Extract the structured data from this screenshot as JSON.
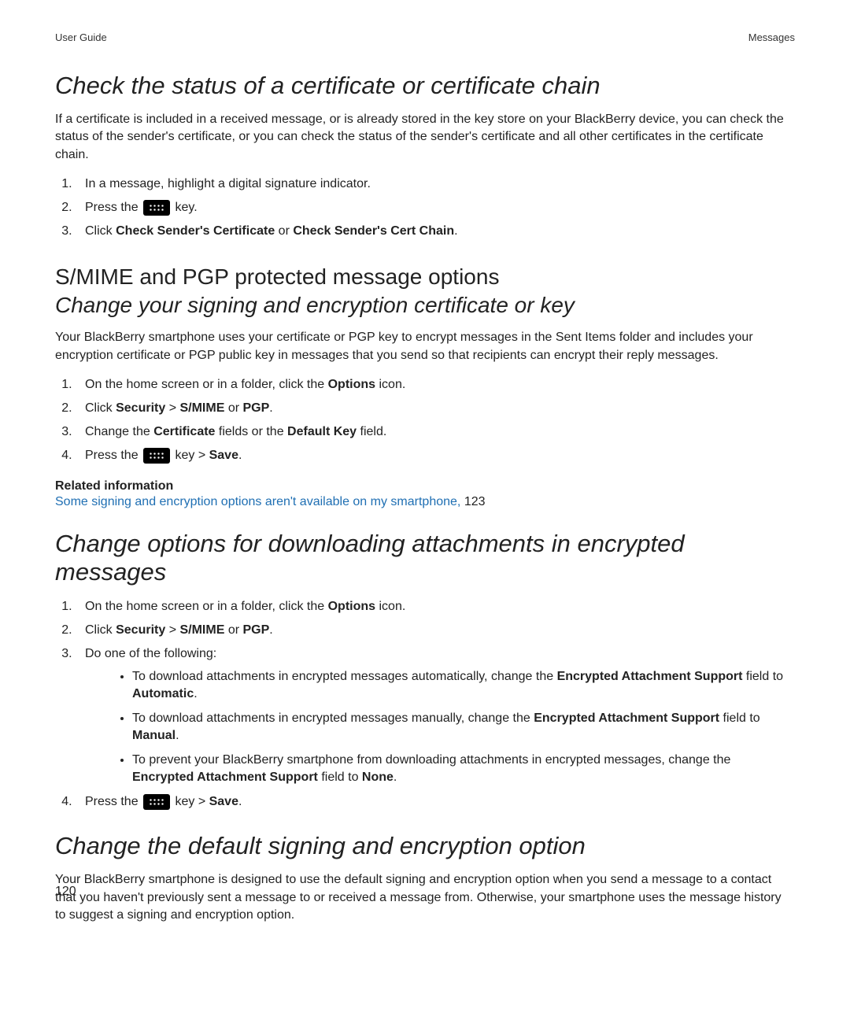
{
  "header": {
    "left": "User Guide",
    "right": "Messages"
  },
  "section1": {
    "title": "Check the status of a certificate or certificate chain",
    "para": "If a certificate is included in a received message, or is already stored in the key store on your BlackBerry device, you can check the status of the sender's certificate, or you can check the status of the sender's certificate and all other certificates in the certificate chain.",
    "steps": {
      "s1": "In a message, highlight a digital signature indicator.",
      "s2_before": "Press the ",
      "s2_after": " key.",
      "s3_a": "Click ",
      "s3_b": "Check Sender's Certificate",
      "s3_c": " or ",
      "s3_d": "Check Sender's Cert Chain",
      "s3_e": "."
    }
  },
  "section2": {
    "title1": "S/MIME and PGP protected message options",
    "title2": "Change your signing and encryption certificate or key",
    "para": "Your BlackBerry smartphone uses your certificate or PGP key to encrypt messages in the Sent Items folder and includes your encryption certificate or PGP public key in messages that you send so that recipients can encrypt their reply messages.",
    "steps": {
      "s1_a": "On the home screen or in a folder, click the ",
      "s1_b": "Options",
      "s1_c": " icon.",
      "s2_a": "Click ",
      "s2_b": "Security",
      "s2_c": " > ",
      "s2_d": "S/MIME",
      "s2_e": " or ",
      "s2_f": "PGP",
      "s2_g": ".",
      "s3_a": "Change the ",
      "s3_b": "Certificate",
      "s3_c": " fields or the ",
      "s3_d": "Default Key",
      "s3_e": " field.",
      "s4_a": "Press the ",
      "s4_b": " key > ",
      "s4_c": "Save",
      "s4_d": "."
    },
    "related_title": "Related information",
    "related_link": "Some signing and encryption options aren't available on my smartphone, ",
    "related_page": "123"
  },
  "section3": {
    "title": "Change options for downloading attachments in encrypted messages",
    "steps": {
      "s1_a": "On the home screen or in a folder, click the ",
      "s1_b": "Options",
      "s1_c": " icon.",
      "s2_a": "Click ",
      "s2_b": "Security",
      "s2_c": " > ",
      "s2_d": "S/MIME",
      "s2_e": " or ",
      "s2_f": "PGP",
      "s2_g": ".",
      "s3": "Do one of the following:",
      "b1_a": "To download attachments in encrypted messages automatically, change the ",
      "b1_b": "Encrypted Attachment Support",
      "b1_c": " field to ",
      "b1_d": "Automatic",
      "b1_e": ".",
      "b2_a": "To download attachments in encrypted messages manually, change the ",
      "b2_b": "Encrypted Attachment Support",
      "b2_c": " field to ",
      "b2_d": "Manual",
      "b2_e": ".",
      "b3_a": "To prevent your BlackBerry smartphone from downloading attachments in encrypted messages, change the ",
      "b3_b": "Encrypted Attachment Support",
      "b3_c": " field to ",
      "b3_d": "None",
      "b3_e": ".",
      "s4_a": "Press the ",
      "s4_b": " key > ",
      "s4_c": "Save",
      "s4_d": "."
    }
  },
  "section4": {
    "title": "Change the default signing and encryption option",
    "para": "Your BlackBerry smartphone is designed to use the default signing and encryption option when you send a message to a contact that you haven't previously sent a message to or received a message from. Otherwise, your smartphone uses the message history to suggest a signing and encryption option."
  },
  "page_number": "120"
}
